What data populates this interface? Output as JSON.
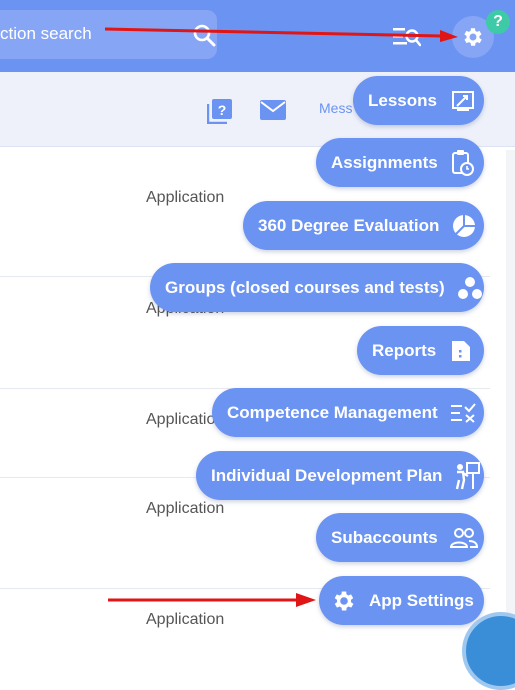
{
  "topbar": {
    "search_text": "ction search",
    "help_badge": "?"
  },
  "subbar": {
    "messages_text": "Mess"
  },
  "list": {
    "rows": [
      {
        "label": "Application"
      },
      {
        "label": "Application"
      },
      {
        "label": "Application"
      },
      {
        "label": "Application"
      },
      {
        "label": "Application"
      }
    ]
  },
  "menu": {
    "items": [
      {
        "label": "Lessons",
        "icon": "lessons-icon"
      },
      {
        "label": "Assignments",
        "icon": "clipboard-clock-icon"
      },
      {
        "label": "360 Degree Evaluation",
        "icon": "pie-chart-icon"
      },
      {
        "label": "Groups (closed courses and tests)",
        "icon": "groups-dots-icon"
      },
      {
        "label": "Reports",
        "icon": "report-icon"
      },
      {
        "label": "Competence Management",
        "icon": "checklist-icon"
      },
      {
        "label": "Individual Development Plan",
        "icon": "presenter-icon"
      },
      {
        "label": "Subaccounts",
        "icon": "users-icon"
      },
      {
        "label": "App Settings",
        "icon": "gear-icon"
      }
    ]
  },
  "colors": {
    "primary": "#6b93f2",
    "header": "#6b93f2",
    "annotation_arrow": "#e01515",
    "help_badge": "#3ec9a7"
  }
}
